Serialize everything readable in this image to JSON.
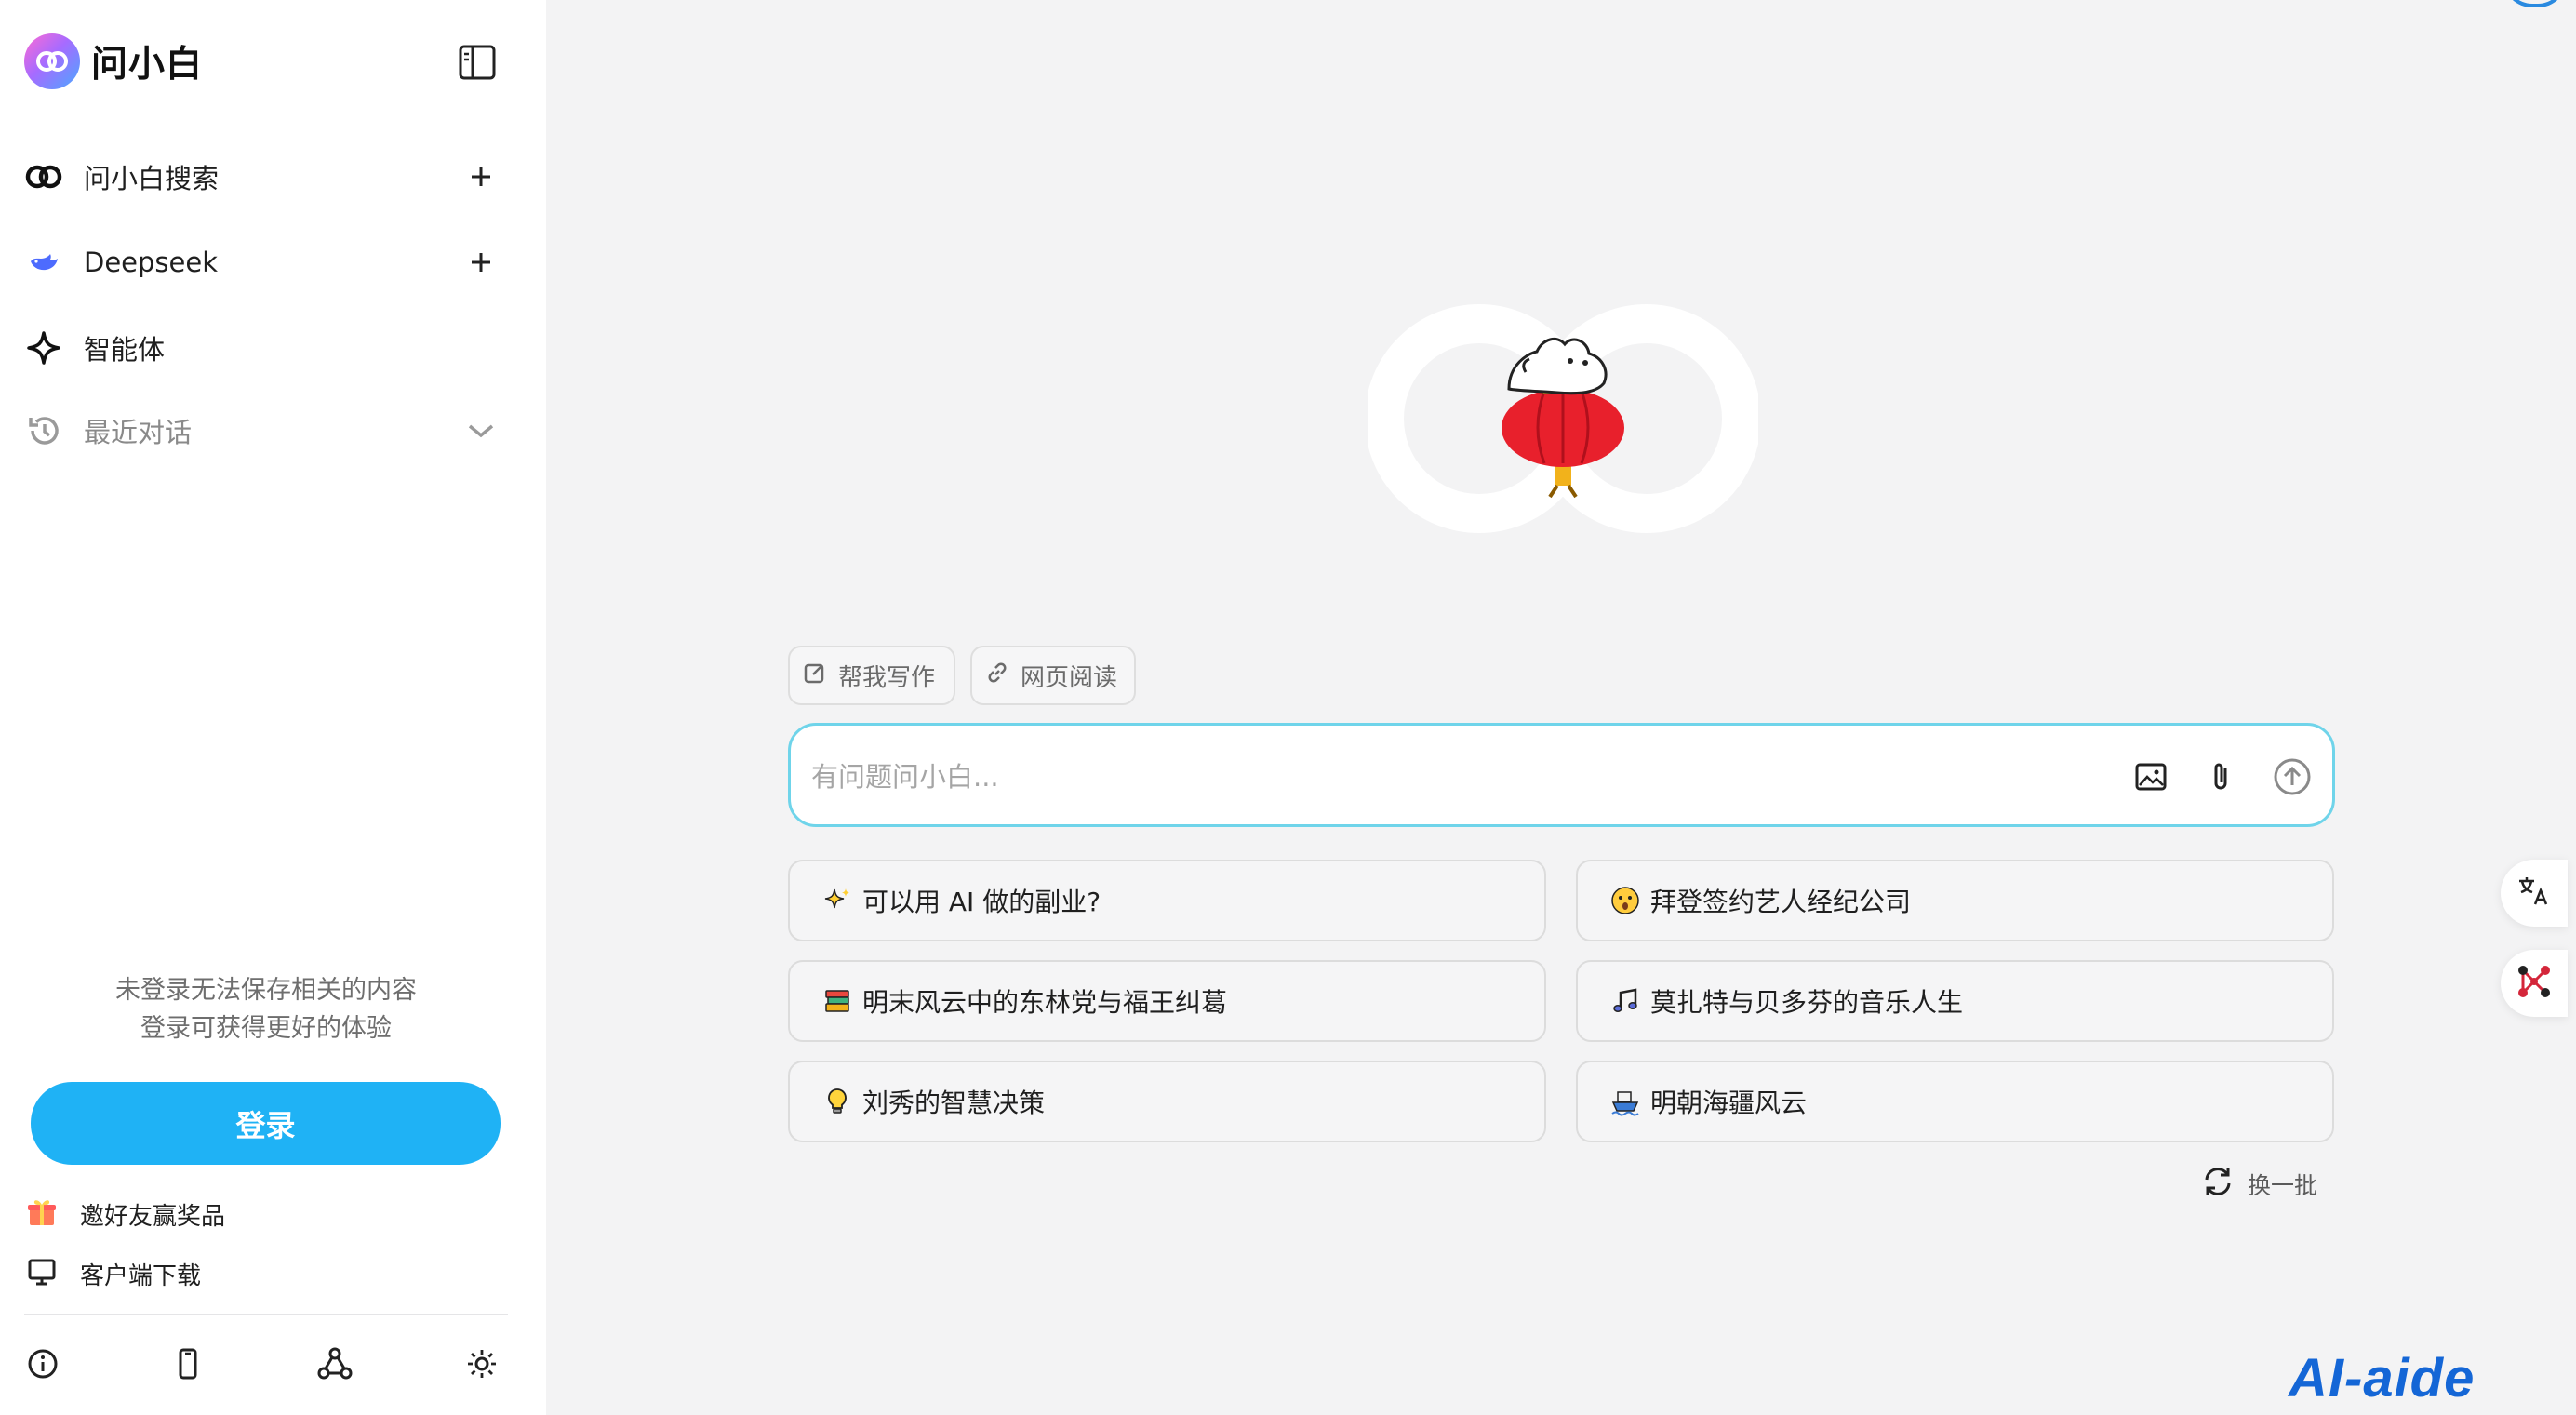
{
  "app": {
    "name": "问小白"
  },
  "sidebar": {
    "nav": [
      {
        "label": "问小白搜索",
        "icon": "link-logo-icon",
        "has_plus": true
      },
      {
        "label": "Deepseek",
        "icon": "whale-icon",
        "has_plus": true
      },
      {
        "label": "智能体",
        "icon": "sparkle-star-icon",
        "has_plus": false
      },
      {
        "label": "最近对话",
        "icon": "history-icon",
        "has_chevron": true
      }
    ],
    "login_tip_line1": "未登录无法保存相关的内容",
    "login_tip_line2": "登录可获得更好的体验",
    "login_button": "登录",
    "links": [
      {
        "label": "邀好友赢奖品",
        "icon": "gift-icon"
      },
      {
        "label": "客户端下载",
        "icon": "monitor-icon"
      }
    ],
    "footer_icons": [
      "info-icon",
      "phone-icon",
      "share-nodes-icon",
      "sun-icon"
    ]
  },
  "main": {
    "chips": [
      {
        "label": "帮我写作",
        "icon": "edit-icon"
      },
      {
        "label": "网页阅读",
        "icon": "link-icon"
      }
    ],
    "input": {
      "placeholder": "有问题问小白..."
    },
    "suggestions": [
      {
        "label": "可以用 AI 做的副业?",
        "icon": "sparkles-icon"
      },
      {
        "label": "拜登签约艺人经纪公司",
        "icon": "surprised-face-icon"
      },
      {
        "label": "明末风云中的东林党与福王纠葛",
        "icon": "books-icon"
      },
      {
        "label": "莫扎特与贝多芬的音乐人生",
        "icon": "music-note-icon"
      },
      {
        "label": "刘秀的智慧决策",
        "icon": "lightbulb-icon"
      },
      {
        "label": "明朝海疆风云",
        "icon": "ship-icon"
      }
    ],
    "refresh_label": "换一批"
  },
  "watermark": "AI-aide",
  "colors": {
    "accent": "#1fb2f5",
    "input_border": "#6fd4ea",
    "background": "#f3f3f4"
  }
}
